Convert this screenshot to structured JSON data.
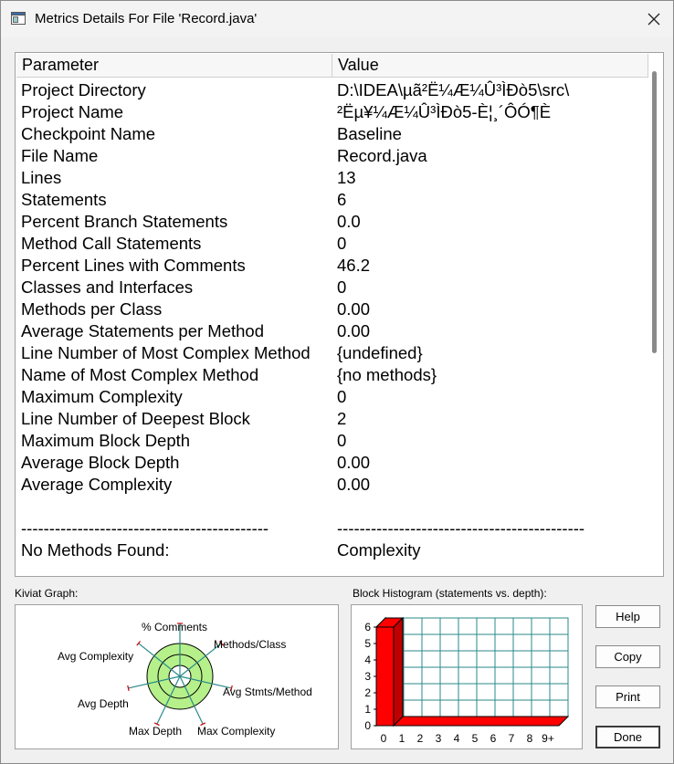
{
  "window": {
    "title": "Metrics Details For File 'Record.java'"
  },
  "table": {
    "headers": [
      "Parameter",
      "Value"
    ],
    "rows": [
      [
        "Project Directory",
        "D:\\IDEA\\µã²Ë¼Æ¼Û³ÌÐò5\\src\\"
      ],
      [
        "Project Name",
        "²Ëµ¥¼Æ¼Û³ÌÐò5-È¦¸´ÔÓ¶È"
      ],
      [
        "Checkpoint Name",
        "Baseline"
      ],
      [
        "File Name",
        "Record.java"
      ],
      [
        "Lines",
        "13"
      ],
      [
        "Statements",
        "6"
      ],
      [
        "Percent Branch Statements",
        "0.0"
      ],
      [
        "Method Call Statements",
        "0"
      ],
      [
        "Percent Lines with Comments",
        "46.2"
      ],
      [
        "Classes and Interfaces",
        "0"
      ],
      [
        "Methods per Class",
        "0.00"
      ],
      [
        "Average Statements per Method",
        "0.00"
      ],
      [
        "Line Number of Most Complex Method",
        "{undefined}"
      ],
      [
        "Name of Most Complex Method",
        "{no methods}"
      ],
      [
        "Maximum Complexity",
        "0"
      ],
      [
        "Line Number of Deepest Block",
        "2"
      ],
      [
        "Maximum Block Depth",
        "0"
      ],
      [
        "Average Block Depth",
        "0.00"
      ],
      [
        "Average Complexity",
        "0.00"
      ],
      [
        "",
        ""
      ],
      [
        "--------------------------------------------",
        "--------------------------------------------"
      ],
      [
        "No Methods Found:",
        "Complexity"
      ]
    ]
  },
  "kiviat": {
    "label": "Kiviat Graph:",
    "axes": [
      "% Comments",
      "Methods/Class",
      "Avg Stmts/Method",
      "Max Complexity",
      "Max Depth",
      "Avg Depth",
      "Avg Complexity"
    ]
  },
  "histogram": {
    "label": "Block Histogram (statements vs. depth):",
    "y_ticks": [
      "0",
      "1",
      "2",
      "3",
      "4",
      "5",
      "6"
    ],
    "x_ticks": [
      "0",
      "1",
      "2",
      "3",
      "4",
      "5",
      "6",
      "7",
      "8",
      "9+"
    ],
    "values": [
      6,
      0,
      0,
      0,
      0,
      0,
      0,
      0,
      0,
      0
    ],
    "ylim": [
      0,
      6
    ]
  },
  "buttons": {
    "help": "Help",
    "copy": "Copy",
    "print": "Print",
    "done": "Done"
  },
  "colors": {
    "bar": "#ff0000",
    "grid": "#2a8a8a",
    "kiviat_fill": "#b6f08a"
  }
}
